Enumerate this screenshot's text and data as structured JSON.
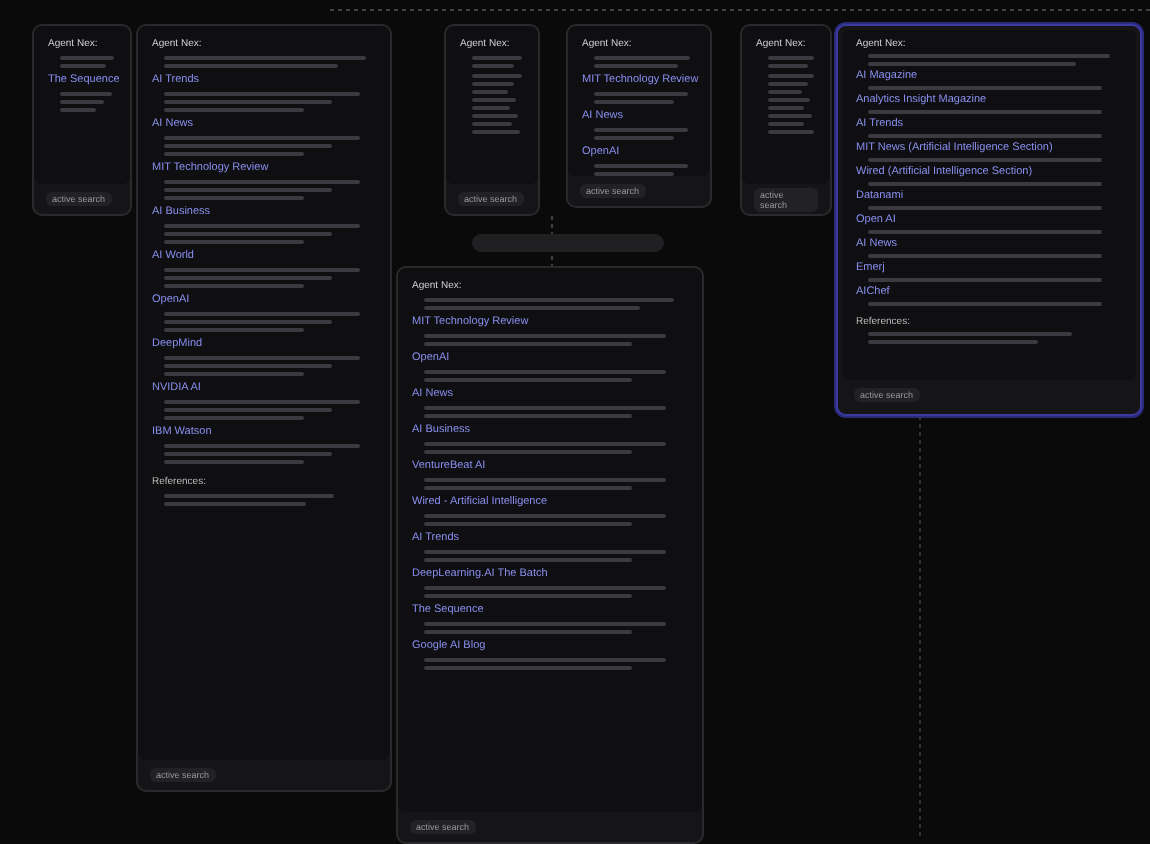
{
  "cards": [
    {
      "header": "Agent Nex:",
      "selected": false,
      "items": [
        {
          "title": "The Sequence"
        }
      ],
      "footer": "active search"
    },
    {
      "header": "Agent Nex:",
      "selected": false,
      "items": [
        {
          "title": "AI Trends"
        },
        {
          "title": "AI News"
        },
        {
          "title": "MIT Technology Review"
        },
        {
          "title": "AI Business"
        },
        {
          "title": "AI World"
        },
        {
          "title": "OpenAI"
        },
        {
          "title": "DeepMind"
        },
        {
          "title": "NVIDIA AI"
        },
        {
          "title": "IBM Watson"
        }
      ],
      "references": "References:",
      "footer": "active search"
    },
    {
      "header": "Agent Nex:",
      "selected": false,
      "footer": "active search"
    },
    {
      "header": "Agent Nex:",
      "selected": false,
      "items": [
        {
          "title": "MIT Technology Review"
        },
        {
          "title": "AI News"
        },
        {
          "title": "OpenAI"
        }
      ],
      "footer": "active search"
    },
    {
      "header": "Agent Nex:",
      "selected": false,
      "footer": "active search"
    },
    {
      "header": "Agent Nex:",
      "selected": true,
      "items": [
        {
          "title": "AI Magazine"
        },
        {
          "title": "Analytics Insight Magazine"
        },
        {
          "title": "AI Trends"
        },
        {
          "title": "MIT News (Artificial Intelligence Section)"
        },
        {
          "title": "Wired (Artificial Intelligence Section)"
        },
        {
          "title": "Datanami"
        },
        {
          "title": "Open AI"
        },
        {
          "title": "AI News"
        },
        {
          "title": "Emerj"
        },
        {
          "title": "AIChef"
        }
      ],
      "references": "References:",
      "footer": "active search"
    },
    {
      "header": "Agent Nex:",
      "selected": false,
      "items": [
        {
          "title": "MIT Technology Review"
        },
        {
          "title": "OpenAI"
        },
        {
          "title": "AI News"
        },
        {
          "title": "AI Business"
        },
        {
          "title": "VentureBeat AI"
        },
        {
          "title": "Wired - Artificial Intelligence"
        },
        {
          "title": "AI Trends"
        },
        {
          "title": "DeepLearning.AI The Batch"
        },
        {
          "title": "The Sequence"
        },
        {
          "title": "Google AI Blog"
        }
      ],
      "footer": "active search"
    }
  ]
}
